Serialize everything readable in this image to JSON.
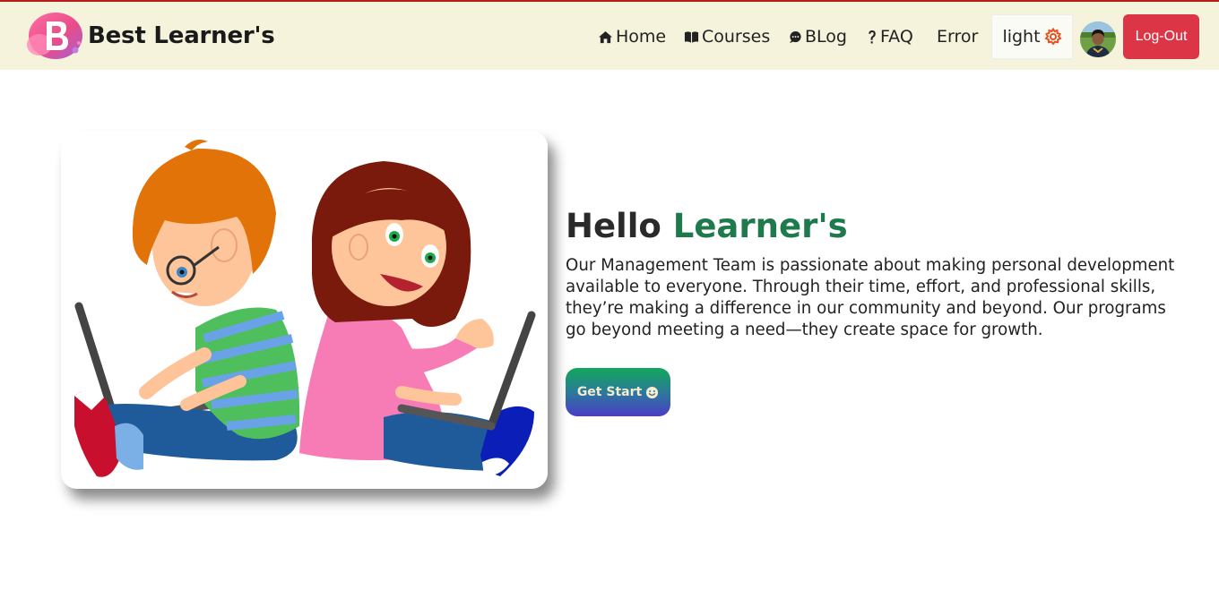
{
  "brand": {
    "name": "Best Learner's",
    "logo_letter": "B"
  },
  "nav": {
    "home": "Home",
    "courses": "Courses",
    "blog": "BLog",
    "faq": "FAQ",
    "error": "Error",
    "theme_label": "light",
    "logout": "Log-Out"
  },
  "hero": {
    "title_plain": "Hello",
    "title_accent": "Learner's",
    "description": "Our Management Team is passionate about making personal development available to everyone. Through their time, effort, and professional skills, they’re making a difference in our community and beyond. Our programs go beyond meeting a need—they create space for growth.",
    "cta_label": "Get Start"
  },
  "colors": {
    "navbar_bg": "#f5f3dc",
    "accent_green": "#1e7a4c",
    "logout_red": "#dc3545",
    "gear_orange": "#e8501e"
  },
  "icons": {
    "home": "home-icon",
    "courses": "book-icon",
    "blog": "chat-icon",
    "faq": "question-icon",
    "theme": "gear-icon",
    "cta": "smile-icon"
  }
}
